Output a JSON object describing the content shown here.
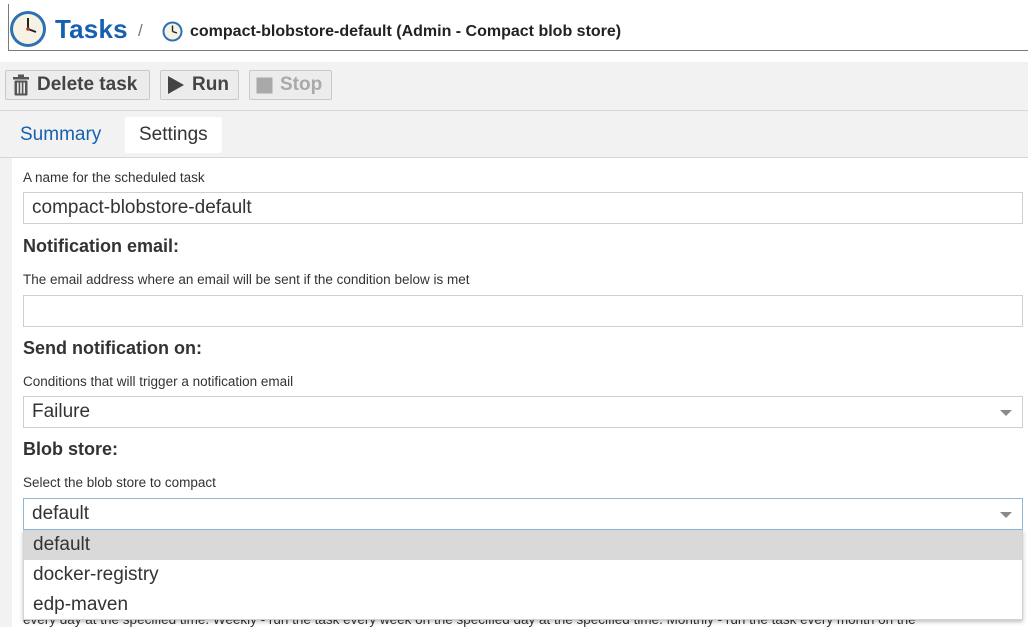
{
  "breadcrumb": {
    "title": "Tasks",
    "separator": "/",
    "task_title": "compact-blobstore-default (Admin - Compact blob store)",
    "title_icon": "clock-icon",
    "task_icon": "clock-icon"
  },
  "toolbar": {
    "delete_label": "Delete task",
    "run_label": "Run",
    "stop_label": "Stop"
  },
  "tabs": [
    {
      "label": "Summary"
    },
    {
      "label": "Settings"
    }
  ],
  "form": {
    "name_help": "A name for the scheduled task",
    "name_value": "compact-blobstore-default",
    "email_heading": "Notification email:",
    "email_help": "The email address where an email will be sent if the condition below is met",
    "email_value": "",
    "notify_heading": "Send notification on:",
    "notify_help": "Conditions that will trigger a notification email",
    "notify_value": "Failure",
    "blob_heading": "Blob store:",
    "blob_help": "Select the blob store to compact",
    "blob_value": "default",
    "schedule_help_partial": "every day at the specified time. Weekly - run the task every week on the specified day at the specified time. Monthly - run the task every month on the"
  },
  "dropdown": {
    "options": [
      "default",
      "docker-registry",
      "edp-maven"
    ],
    "selected": "default"
  },
  "colors": {
    "accent": "#1660b0",
    "toolbar_bg": "#f2f2f2",
    "selected_option_bg": "#d9d9d9"
  }
}
